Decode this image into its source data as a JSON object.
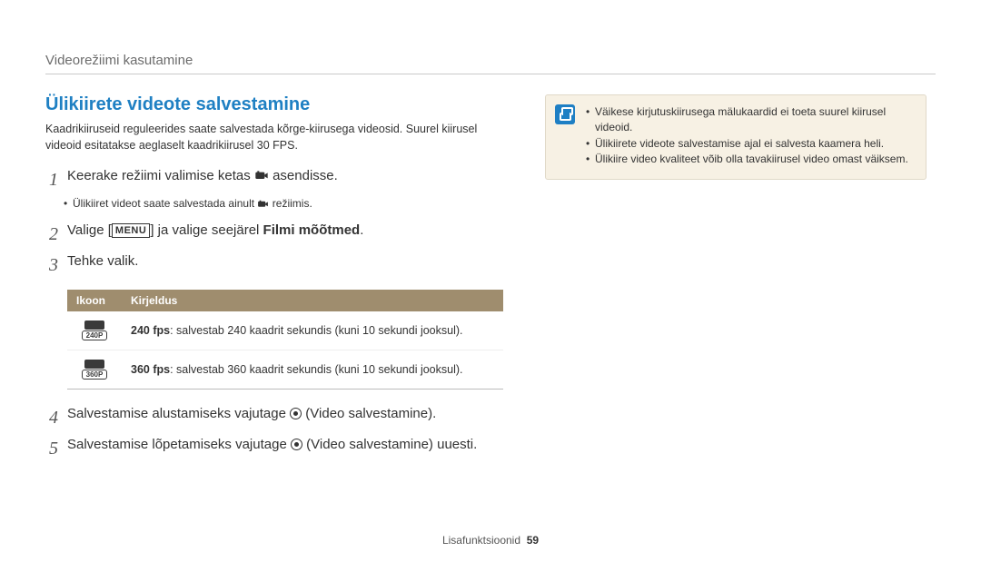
{
  "breadcrumb": "Videorežiimi kasutamine",
  "title": "Ülikiirete videote salvestamine",
  "intro": "Kaadrikiiruseid reguleerides saate salvestada kõrge-kiirusega videosid. Suurel kiirusel videoid esitatakse aeglaselt kaadrikiirusel 30 FPS.",
  "steps": {
    "s1_a": "Keerake režiimi valimise ketas ",
    "s1_b": " asendisse.",
    "s1_note_a": "Ülikiiret videot saate salvestada ainult ",
    "s1_note_b": " režiimis.",
    "s2_a": "Valige [",
    "s2_menu": "MENU",
    "s2_b": "] ja valige seejärel ",
    "s2_bold": "Filmi mõõtmed",
    "s3": "Tehke valik.",
    "s4_a": "Salvestamise alustamiseks vajutage ",
    "s4_b": " (Video salvestamine).",
    "s5_a": "Salvestamise lõpetamiseks vajutage ",
    "s5_b": " (Video salvestamine) uuesti."
  },
  "table": {
    "headers": {
      "icon": "Ikoon",
      "desc": "Kirjeldus"
    },
    "rows": [
      {
        "badge": "240P",
        "bold": "240 fps",
        "rest": ": salvestab 240 kaadrit sekundis (kuni 10 sekundi jooksul)."
      },
      {
        "badge": "360P",
        "bold": "360 fps",
        "rest": ": salvestab 360 kaadrit sekundis (kuni 10 sekundi jooksul)."
      }
    ]
  },
  "notes": {
    "items": [
      "Väikese kirjutuskiirusega mälukaardid ei toeta suurel kiirusel videoid.",
      "Ülikiirete videote salvestamise ajal ei salvesta kaamera heli.",
      "Ülikiire video kvaliteet võib olla tavakiirusel video omast väiksem."
    ]
  },
  "footer": {
    "label": "Lisafunktsioonid",
    "page": "59"
  }
}
